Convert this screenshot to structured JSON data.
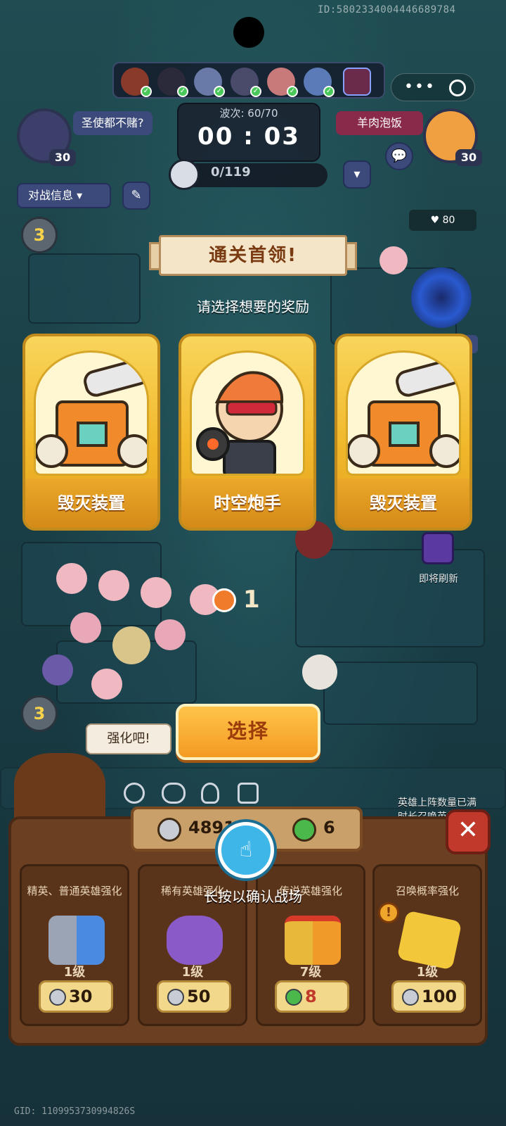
{
  "top": {
    "id_text": "ID:5802334004446689784",
    "phase_icons": [
      "fire-hero-icon",
      "dark-hero-icon",
      "sword-icon",
      "robot-hero-icon",
      "pink-hero-icon",
      "blue-hero-icon",
      "boss-icon"
    ],
    "menu_icon": "more-dots-icon",
    "target_icon": "record-icon"
  },
  "player_left": {
    "name": "圣使都不赌?",
    "level": "30"
  },
  "player_right": {
    "name": "羊肉泡饭",
    "level": "30"
  },
  "wave": {
    "label": "波次: 60/70",
    "timer": "00 : 03"
  },
  "kills": {
    "text": "0/119"
  },
  "battle_info": {
    "label": "对战信息"
  },
  "left_badges": {
    "top": "3",
    "bottom": "3"
  },
  "right": {
    "hearts": "80",
    "enemy_tag": "泡饭",
    "refresh_label": "即将刷新",
    "notice_line1": "英雄上阵数量已满",
    "notice_line2": "时长召唤英雄…"
  },
  "overlay": {
    "banner_title": "通关首领!",
    "subtitle": "请选择想要的奖励",
    "cards": [
      {
        "name": "毁灭装置",
        "art": "destruction-device"
      },
      {
        "name": "时空炮手",
        "art": "time-gunner"
      },
      {
        "name": "毁灭装置",
        "art": "destruction-device"
      }
    ],
    "countdown": "1",
    "select_label": "选择",
    "speech": "强化吧!"
  },
  "upgrade_panel": {
    "silver": "48910",
    "clover": "6",
    "hint": "长按以确认战场",
    "cards": [
      {
        "title": "精英、普通英雄强化",
        "level": "1级",
        "cost": "30",
        "currency": "silver"
      },
      {
        "title": "稀有英雄强化",
        "level": "1级",
        "cost": "50",
        "currency": "silver"
      },
      {
        "title": "传说英雄强化",
        "level": "7级",
        "cost": "8",
        "currency": "clover"
      },
      {
        "title": "召唤概率强化",
        "level": "1级",
        "cost": "100",
        "currency": "silver"
      }
    ]
  },
  "bottom": {
    "gid": "GID: 1109953730994826S"
  },
  "colors": {
    "accent": "#f39a22",
    "card_gold": "#f2b92c",
    "panel_brown": "#6b3f22",
    "positive": "#4ac95a",
    "close_red": "#c0392b"
  }
}
